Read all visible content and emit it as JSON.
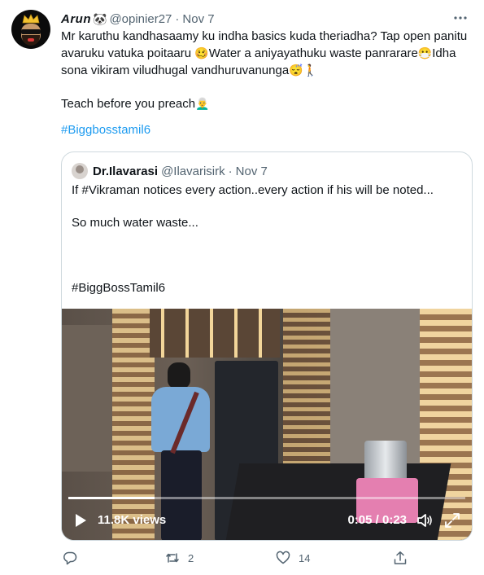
{
  "tweet": {
    "display_name": "Arun",
    "name_emoji": "🐼",
    "handle": "@opinier27",
    "date": "Nov 7",
    "line1": "Mr karuthu kandhasaamy ku indha basics kuda theriadha? Tap open panitu",
    "line2a": "avaruku vatuka poitaaru ",
    "emoji1": "🥴",
    "line2b": "Water a aniyayathuku waste panrarare",
    "emoji2": "😷",
    "line2c": "Idha",
    "line3a": "sona vikiram viludhugal vandhuruvanunga",
    "emoji3": "😴",
    "emoji4": "🚶",
    "line4a": "Teach before you preach",
    "emoji5": "👨‍🦳",
    "hashtag": "#Biggbosstamil6"
  },
  "quote": {
    "display_name": "Dr.Ilavarasi",
    "handle": "@Ilavarisirk",
    "date": "Nov 7",
    "line1": "If #Vikraman notices every action..every action if his will be noted...",
    "line2": "So much water waste...",
    "line3": "#BiggBossTamil6"
  },
  "video": {
    "views": "11.8K views",
    "time": "0:05 / 0:23",
    "progress_fraction": 0.2174
  },
  "actions": {
    "retweets": "2",
    "likes": "14"
  }
}
